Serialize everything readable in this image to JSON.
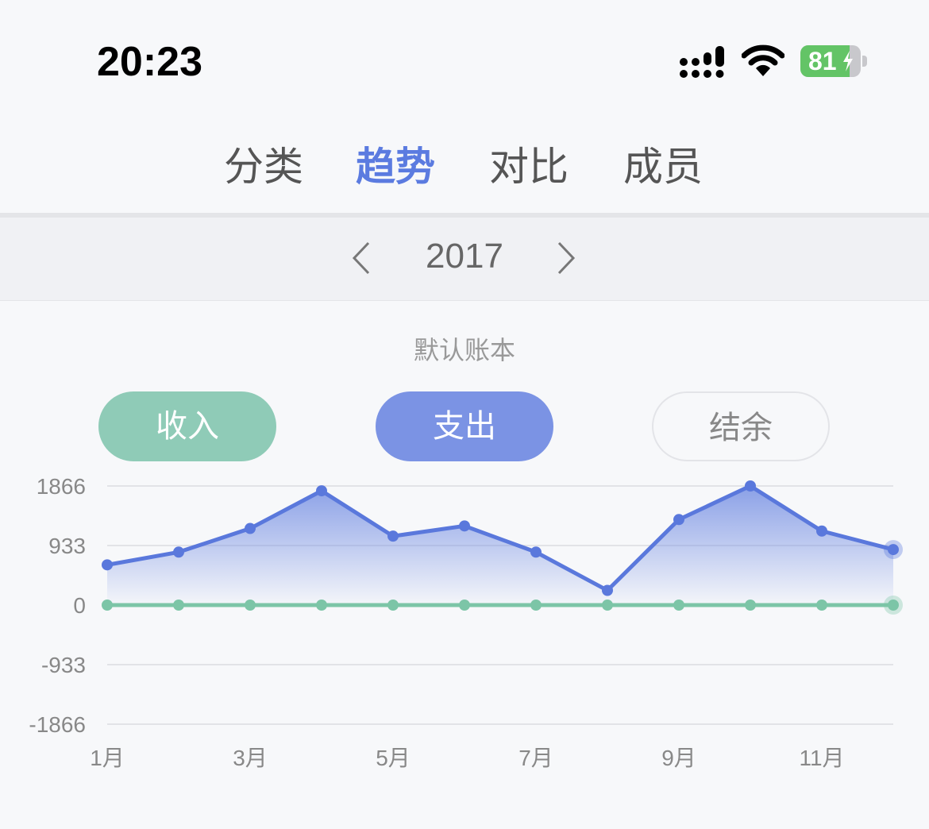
{
  "status": {
    "time": "20:23",
    "battery": "81",
    "battery_level": 0.81,
    "icons": [
      "signal-icon",
      "wifi-icon",
      "battery-icon"
    ]
  },
  "tabs": [
    {
      "label": "分类",
      "active": false
    },
    {
      "label": "趋势",
      "active": true
    },
    {
      "label": "对比",
      "active": false
    },
    {
      "label": "成员",
      "active": false
    }
  ],
  "year_nav": {
    "year": "2017",
    "prev_icon": "chevron-left-icon",
    "next_icon": "chevron-right-icon"
  },
  "book_title": "默认账本",
  "pills": {
    "income": "收入",
    "expense": "支出",
    "balance": "结余"
  },
  "colors": {
    "accent": "#5b7be0",
    "expense_line": "#5a78dc",
    "income_line": "#7cc5a7",
    "income_pill": "#8fcbb7",
    "expense_pill": "#7b93e4"
  },
  "chart_data": {
    "type": "line",
    "x": [
      "1月",
      "2月",
      "3月",
      "4月",
      "5月",
      "6月",
      "7月",
      "8月",
      "9月",
      "10月",
      "11月",
      "12月"
    ],
    "x_tick_labels": [
      "1月",
      "3月",
      "5月",
      "7月",
      "9月",
      "11月"
    ],
    "y_ticks": [
      1866,
      933,
      0,
      -933,
      -1866
    ],
    "ylim": [
      -1866,
      1866
    ],
    "grid": true,
    "series": [
      {
        "name": "支出",
        "color": "#5a78dc",
        "area": true,
        "values": [
          630,
          830,
          1200,
          1790,
          1080,
          1240,
          830,
          230,
          1340,
          1866,
          1160,
          870
        ]
      },
      {
        "name": "收入",
        "color": "#7cc5a7",
        "area": false,
        "values": [
          0,
          0,
          0,
          0,
          0,
          0,
          0,
          0,
          0,
          0,
          0,
          0
        ]
      }
    ]
  }
}
